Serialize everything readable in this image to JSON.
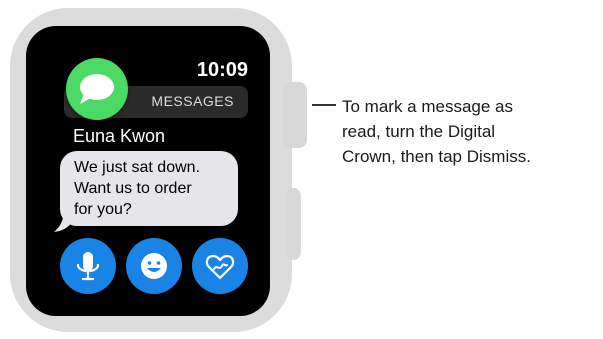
{
  "notification": {
    "time": "10:09",
    "app_name": "MESSAGES",
    "sender": "Euna Kwon",
    "message": "We just sat down.\nWant us to order\nfor you?"
  },
  "actions": [
    {
      "icon": "microphone-icon",
      "label": "Dictate"
    },
    {
      "icon": "smiley-icon",
      "label": "Emoji"
    },
    {
      "icon": "heart-sketch-icon",
      "label": "Digital Touch"
    }
  ],
  "caption": {
    "text": "To mark a message as\nread, turn the Digital\nCrown, then tap Dismiss."
  },
  "colors": {
    "case": "#dcdcdc",
    "screen": "#000000",
    "messages_green": "#4cd964",
    "action_blue": "#1a84e6",
    "bubble_gray": "#e5e5ea"
  }
}
